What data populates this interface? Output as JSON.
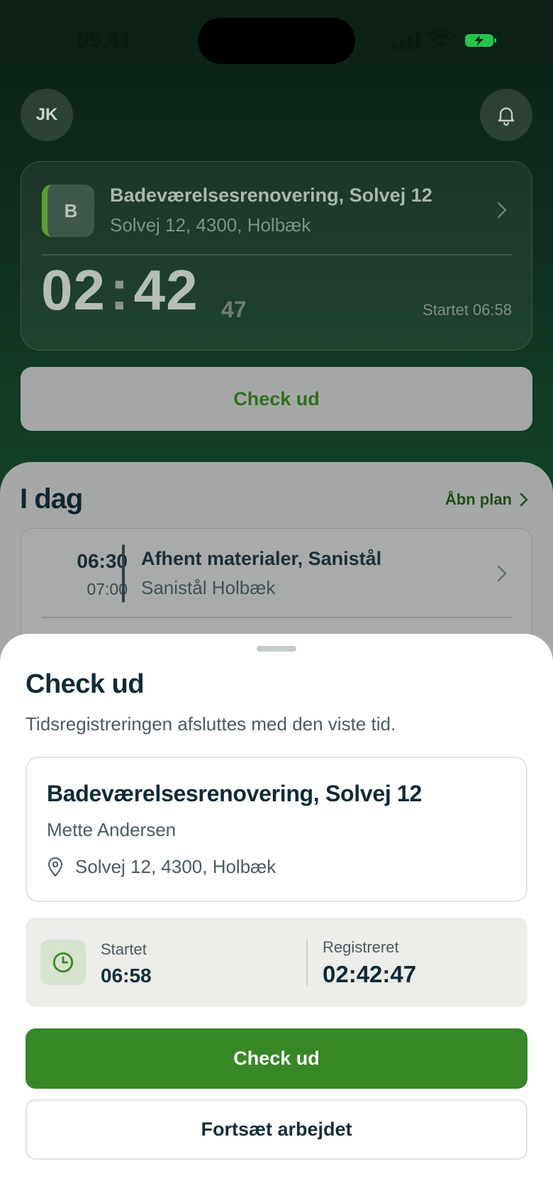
{
  "status_bar": {
    "time": "09.41"
  },
  "header": {
    "avatar_initials": "JK"
  },
  "active_timer": {
    "project_letter": "B",
    "project_title": "Badeværelsesrenovering, Solvej 12",
    "address": "Solvej 12, 4300, Holbæk",
    "hours": "02",
    "minutes": "42",
    "seconds": "47",
    "started_text": "Startet 06:58",
    "checkout_label": "Check ud"
  },
  "today": {
    "title": "I dag",
    "open_plan_label": "Åbn plan",
    "tasks": [
      {
        "start": "06:30",
        "end": "07:00",
        "title": "Afhent materialer, Sanistål",
        "location": "Sanistål Holbæk"
      }
    ]
  },
  "sheet": {
    "title": "Check ud",
    "description": "Tidsregistreringen afsluttes med den viste tid.",
    "project_title": "Badeværelsesrenovering, Solvej 12",
    "client": "Mette Andersen",
    "address": "Solvej 12, 4300, Holbæk",
    "started_label": "Startet",
    "started_value": "06:58",
    "registered_label": "Registreret",
    "registered_value": "02:42:47",
    "confirm_label": "Check ud",
    "continue_label": "Fortsæt arbejdet"
  },
  "colors": {
    "accent_green": "#378727",
    "background_dark": "#0f2a1c"
  }
}
